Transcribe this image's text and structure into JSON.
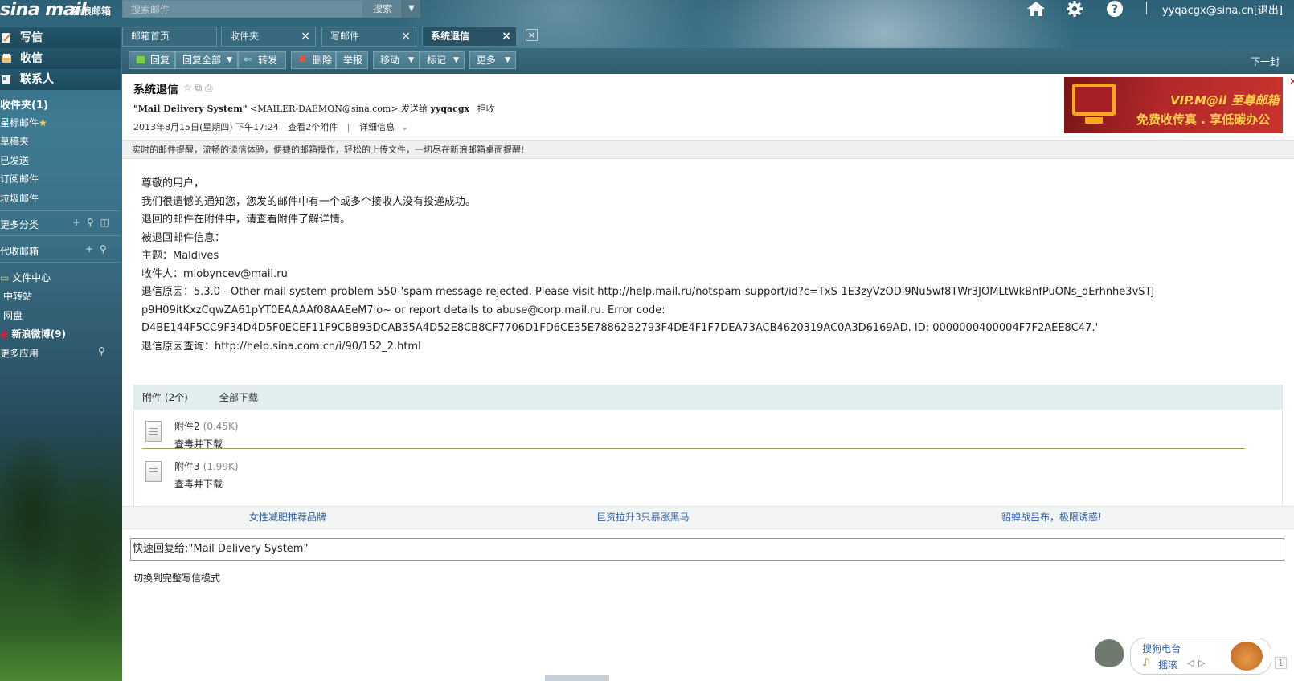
{
  "app": {
    "logo_brand": "sina mail",
    "logo_cn": "新浪邮箱",
    "search_placeholder": "搜索邮件",
    "search_button": "搜索",
    "user_email": "yyqacgx@sina.cn",
    "logout_label": "[退出]"
  },
  "sidebar": {
    "compose": "写信",
    "inbox": "收信",
    "contacts": "联系人",
    "folders_title": "收件夹(1)",
    "folders": [
      "星标邮件",
      "草稿夹",
      "已发送",
      "订阅邮件",
      "垃圾邮件"
    ],
    "more_categories": "更多分类",
    "proxy_mailbox": "代收邮箱",
    "file_center": "文件中心",
    "file_center_items": [
      "中转站",
      "网盘"
    ],
    "weibo": "新浪微博(9)",
    "more_apps": "更多应用"
  },
  "tabs": [
    {
      "label": "邮箱首页",
      "closable": false
    },
    {
      "label": "收件夹",
      "closable": true
    },
    {
      "label": "写邮件",
      "closable": true
    },
    {
      "label": "系统退信",
      "closable": true,
      "active": true
    }
  ],
  "toolbar": {
    "reply": "回复",
    "reply_all": "回复全部",
    "forward": "转发",
    "delete": "删除",
    "report": "举报",
    "move": "移动",
    "mark": "标记",
    "more": "更多",
    "next": "下一封"
  },
  "mail": {
    "subject": "系统退信",
    "from_name": "\"Mail Delivery System\"",
    "from_addr": "<MAILER-DAEMON@sina.com>",
    "sent_to_label": "发送给",
    "sent_to": "yyqacgx",
    "reject": "拒收",
    "date": "2013年8月15日(星期四) 下午17:24",
    "view_attachments": "查看2个附件",
    "details": "详细信息",
    "tip": "实时的邮件提醒，流畅的读信体验，便捷的邮箱操作，轻松的上传文件，一切尽在新浪邮箱桌面提醒!",
    "body": [
      "尊敬的用户，",
      "我们很遗憾的通知您，您发的邮件中有一个或多个接收人没有投递成功。",
      "退回的邮件在附件中，请查看附件了解详情。",
      "被退回邮件信息：",
      "主题：Maldives",
      "收件人：mlobyncev@mail.ru",
      "退信原因：5.3.0 - Other mail system problem 550-'spam message rejected. Please visit http://help.mail.ru/notspam-support/id?c=TxS-1E3zyVzODl9Nu5wf8TWr3JOMLtWkBnfPuONs_dErhnhe3vSTJ-",
      "p9H09itKxzCqwZA61pYT0EAAAAf08AAEeM7io~ or report details to abuse@corp.mail.ru. Error code:",
      "D4BE144F5CC9F34D4D5F0ECEF11F9CBB93DCAB35A4D52E8CB8CF7706D1FD6CE35E78862B2793F4DE4F1F7DEA73ACB4620319AC0A3D6169AD. ID: 0000000400004F7F2AEE8C47.'"
    ],
    "query_label": "退信原因查询：",
    "query_link": "http://help.sina.com.cn/i/90/152_2.html"
  },
  "ad": {
    "line1": "VIP.M@il 至尊邮箱",
    "line2": "免费收传真 . 享低碳办公"
  },
  "attachments": {
    "title": "附件 (2个)",
    "download_all": "全部下载",
    "items": [
      {
        "name": "附件2",
        "size": "(0.45K)",
        "action": "查毒并下载"
      },
      {
        "name": "附件3",
        "size": "(1.99K)",
        "action": "查毒并下载"
      }
    ]
  },
  "ad_links": [
    "女性减肥推荐品牌",
    "巨资拉升3只暴涨黑马",
    "貂蝉战吕布，极限诱惑!"
  ],
  "quick_reply": {
    "text": "快速回复给:\"Mail Delivery System\"",
    "switch": "切换到完整写信模式"
  },
  "radio": {
    "title": "搜狗电台",
    "shake": "摇滚",
    "count": "1"
  }
}
